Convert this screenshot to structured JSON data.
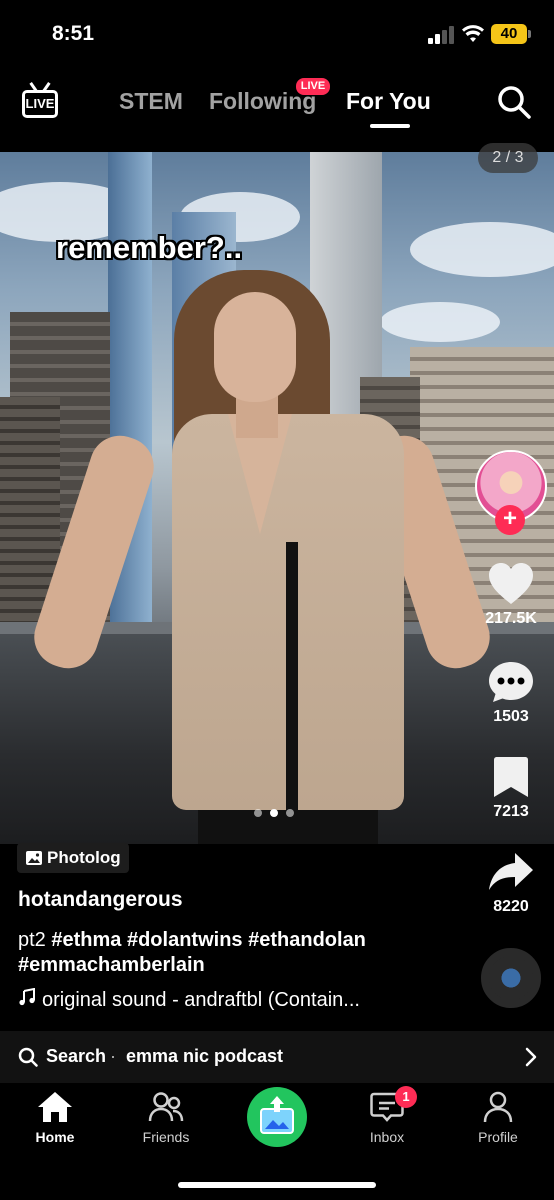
{
  "status_bar": {
    "time": "8:51",
    "battery": "40"
  },
  "top_nav": {
    "live_label": "LIVE",
    "tabs": [
      {
        "label": "STEM"
      },
      {
        "label": "Following",
        "badge": "LIVE"
      },
      {
        "label": "For You",
        "active": true
      }
    ]
  },
  "video": {
    "caption_overlay": "remember?..",
    "page_counter": "2 / 3",
    "current_image": 2,
    "total_images": 3
  },
  "actions": {
    "likes": "217.5K",
    "comments": "1503",
    "saves": "7213",
    "shares": "8220"
  },
  "post": {
    "badge": "Photolog",
    "username": "hotandangerous",
    "description_prefix": "pt2",
    "hashtags": [
      "#ethma",
      "#dolantwins",
      "#ethandolan",
      "#emmachamberlain"
    ],
    "sound": "original sound - andraftbl (Contain..."
  },
  "search_bar": {
    "label": "Search",
    "separator": "·",
    "query": "emma nic podcast"
  },
  "tab_bar": {
    "items": [
      {
        "label": "Home",
        "icon": "home-icon"
      },
      {
        "label": "Friends",
        "icon": "friends-icon"
      },
      {
        "label": "",
        "icon": "create-icon"
      },
      {
        "label": "Inbox",
        "icon": "inbox-icon",
        "badge": "1"
      },
      {
        "label": "Profile",
        "icon": "profile-icon"
      }
    ]
  },
  "colors": {
    "accent": "#fe2c55",
    "create_button": "#22c55e",
    "battery": "#f5c518"
  }
}
